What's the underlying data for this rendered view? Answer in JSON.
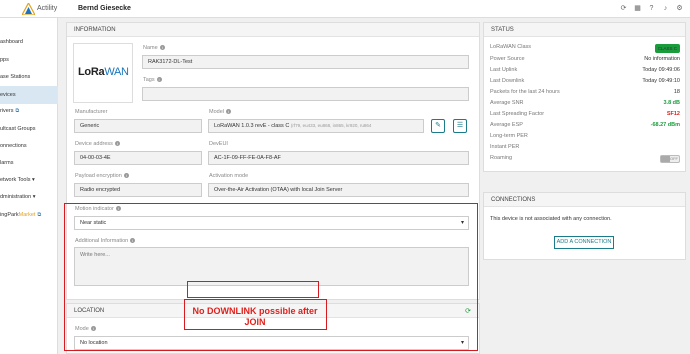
{
  "app": {
    "brand": "Actility",
    "user": "Bernd Giesecke"
  },
  "topbar_icons": [
    "refresh-icon",
    "grid-icon",
    "help-icon",
    "bell-icon",
    "settings-icon"
  ],
  "sidebar": {
    "items": [
      {
        "label": "ashboard"
      },
      {
        "label": "pps"
      },
      {
        "label": "ase Stations"
      },
      {
        "label": "evices",
        "active": true
      },
      {
        "label": "rivers",
        "ext": "⧉"
      },
      {
        "label": "ultcast Groups"
      },
      {
        "label": "onnections"
      },
      {
        "label": "larms"
      },
      {
        "label": "etwork Tools",
        "caret": "▾"
      },
      {
        "label": "dministration",
        "caret": "▾"
      }
    ],
    "market_prefix": "ingPark",
    "market_suffix": "Market",
    "market_ext": "⧉"
  },
  "information": {
    "title": "INFORMATION",
    "name_label": "Name",
    "name_value": "RAK3172-DL-Test",
    "tags_label": "Tags",
    "manufacturer_label": "Manufacturer",
    "manufacturer_value": "Generic",
    "model_label": "Model",
    "model_value": "LoRaWAN 1.0.3 revE - class C",
    "model_sub": "(rf79, eu433, eu868, in865, kr920, ru864",
    "device_address_label": "Device address",
    "device_address_value": "04-00-03-4E",
    "deveui_label": "DevEUI",
    "deveui_value": "AC-1F-09-FF-FE-0A-F8-AF",
    "payload_label": "Payload encryption",
    "payload_value": "Radio encrypted",
    "activation_label": "Activation mode",
    "activation_value": "Over-the-Air Activation (OTAA) with local Join Server",
    "motion_label": "Motion indicator",
    "motion_value": "Near static",
    "additional_label": "Additional Information",
    "additional_placeholder": "Write here..."
  },
  "logo": {
    "lora": "LoRa",
    "wan": "WAN"
  },
  "location": {
    "title": "LOCATION",
    "mode_label": "Mode",
    "mode_value": "No location"
  },
  "status": {
    "title": "STATUS",
    "rows": [
      {
        "label": "LoRaWAN Class",
        "value": "CLASS C",
        "kind": "badge"
      },
      {
        "label": "Power Source",
        "value": "No information"
      },
      {
        "label": "Last Uplink",
        "value": "Today 09:49:06"
      },
      {
        "label": "Last Downlink",
        "value": "Today 09:49:10"
      },
      {
        "label": "Packets for the last 24 hours",
        "value": "18"
      },
      {
        "label": "Average SNR",
        "value": "3.8 dB",
        "kind": "green"
      },
      {
        "label": "Last Spreading Factor",
        "value": "SF12",
        "kind": "red"
      },
      {
        "label": "Average ESP",
        "value": "-68.27 dBm",
        "kind": "green"
      },
      {
        "label": "Long-term PER",
        "value": ""
      },
      {
        "label": "Instant PER",
        "value": ""
      },
      {
        "label": "Roaming",
        "value": "OFF",
        "kind": "toggle"
      }
    ]
  },
  "connections": {
    "title": "CONNECTIONS",
    "empty_text": "This device is not associated with any connection.",
    "add_label": "ADD A CONNECTION"
  },
  "annotation": {
    "text": "No DOWNLINK possible after JOIN"
  },
  "colors": {
    "accent": "#1a7b8a",
    "good": "#1a9c3d",
    "bad": "#e0201b",
    "annotation": "#d71920"
  }
}
